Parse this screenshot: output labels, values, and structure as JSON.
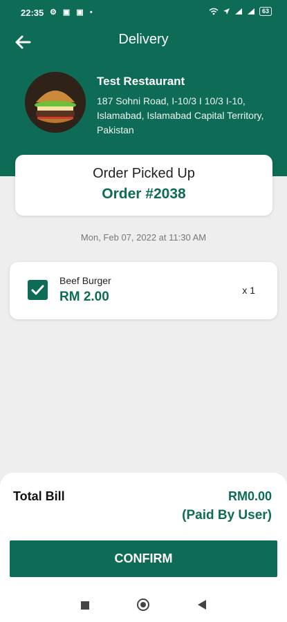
{
  "status_bar": {
    "time": "22:35",
    "icons": [
      "gear-icon",
      "app-icon",
      "app-icon",
      "dot"
    ],
    "right_icons": [
      "wifi-icon",
      "location-icon",
      "signal-icon",
      "signal-icon"
    ],
    "battery": "63"
  },
  "header": {
    "title": "Delivery",
    "back_icon": "arrow-left-icon"
  },
  "restaurant": {
    "name": "Test Restaurant",
    "address": "187 Sohni Road, I-10/3 I 10/3 I-10, Islamabad, Islamabad Capital Territory, Pakistan",
    "image": "burger-photo"
  },
  "order": {
    "status": "Order Picked Up",
    "number": "Order #2038",
    "datetime": "Mon, Feb 07, 2022 at 11:30 AM"
  },
  "items": [
    {
      "name": "Beef Burger",
      "price": "RM 2.00",
      "qty": "x 1",
      "checked": true
    }
  ],
  "bill": {
    "label": "Total Bill",
    "amount": "RM0.00",
    "note": "(Paid By User)"
  },
  "confirm_label": "CONFIRM",
  "colors": {
    "primary": "#0e6b55",
    "background": "#eeeeee"
  }
}
